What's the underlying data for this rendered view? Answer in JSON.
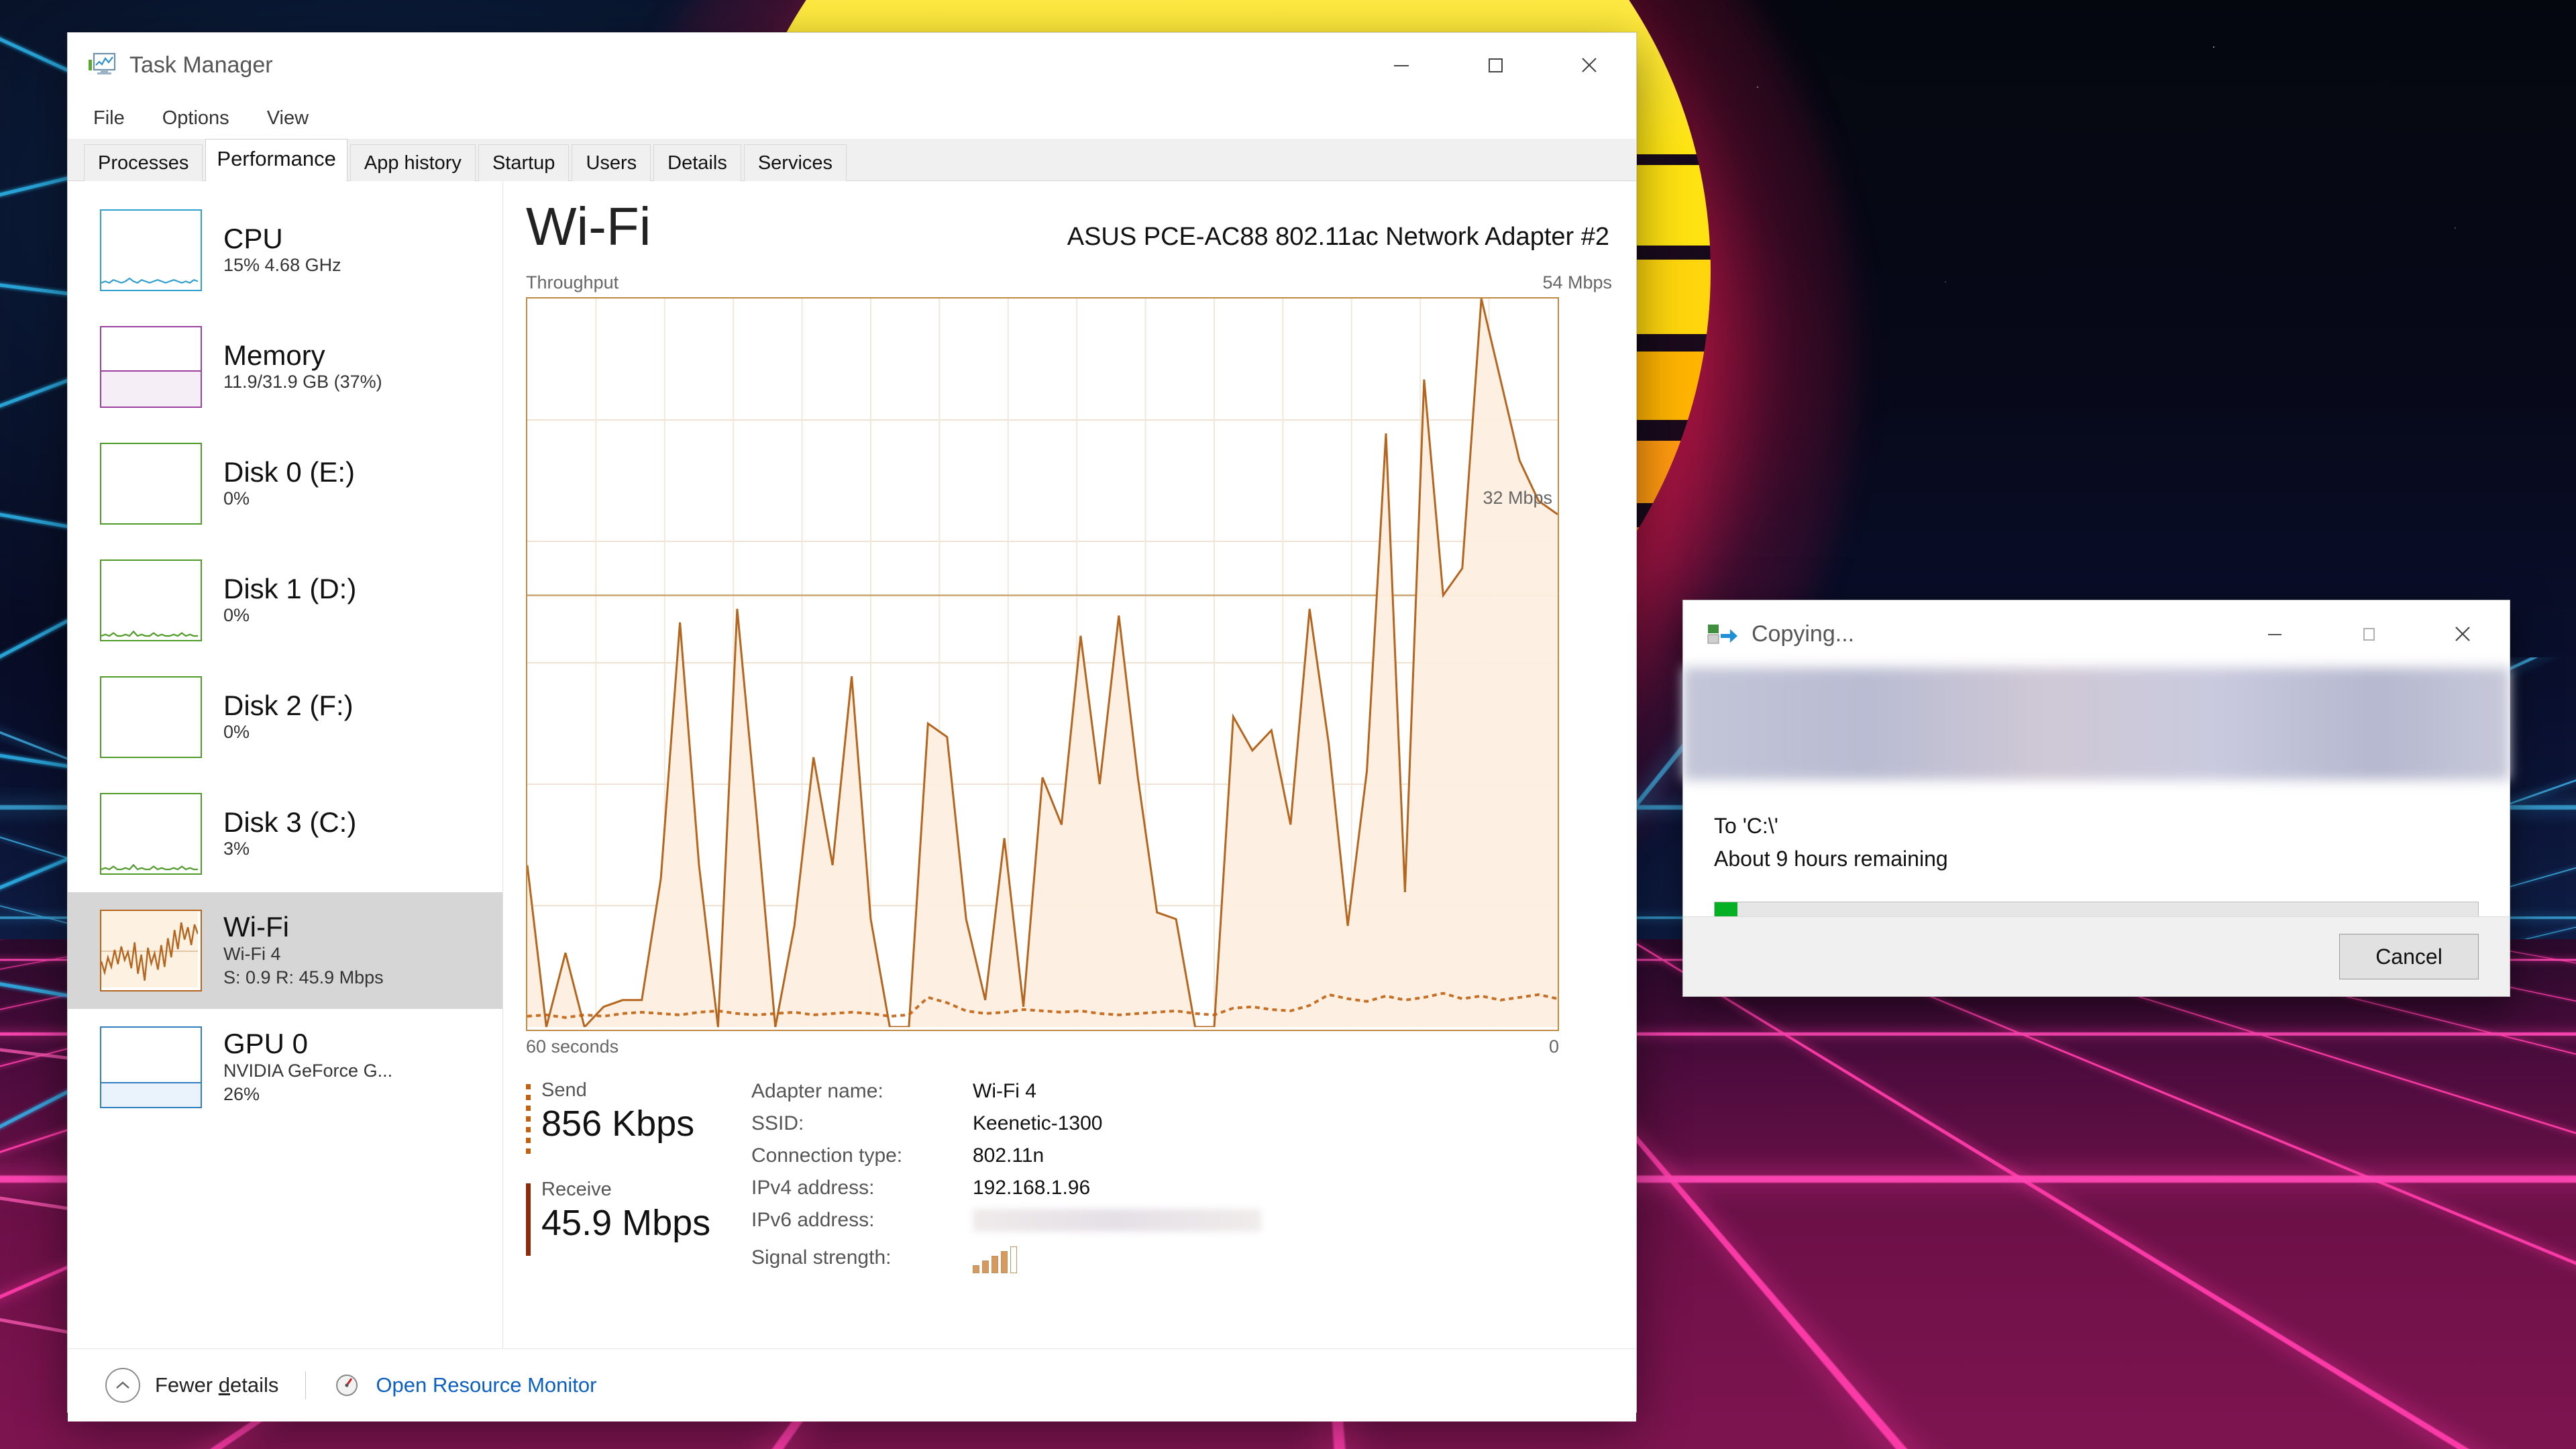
{
  "taskmanager": {
    "title": "Task Manager",
    "icon": "task-manager-icon",
    "caption": {
      "minimize": "–",
      "maximize": "□",
      "close": "✕"
    },
    "menu": [
      "File",
      "Options",
      "View"
    ],
    "tabs": [
      {
        "label": "Processes",
        "active": false
      },
      {
        "label": "Performance",
        "active": true
      },
      {
        "label": "App history",
        "active": false
      },
      {
        "label": "Startup",
        "active": false
      },
      {
        "label": "Users",
        "active": false
      },
      {
        "label": "Details",
        "active": false
      },
      {
        "label": "Services",
        "active": false
      }
    ],
    "sidebar": [
      {
        "name": "CPU",
        "sub1": "15%  4.68 GHz",
        "sub2": "",
        "color": "#2f9fd0",
        "fill": "#ffffff",
        "selected": false,
        "spark": "cpu"
      },
      {
        "name": "Memory",
        "sub1": "11.9/31.9 GB (37%)",
        "sub2": "",
        "color": "#9b3fa0",
        "fill": "#f6eef7",
        "selected": false,
        "spark": "mem"
      },
      {
        "name": "Disk 0 (E:)",
        "sub1": "0%",
        "sub2": "",
        "color": "#4f9b27",
        "fill": "#ffffff",
        "selected": false,
        "spark": "flat"
      },
      {
        "name": "Disk 1 (D:)",
        "sub1": "0%",
        "sub2": "",
        "color": "#4f9b27",
        "fill": "#ffffff",
        "selected": false,
        "spark": "low"
      },
      {
        "name": "Disk 2 (F:)",
        "sub1": "0%",
        "sub2": "",
        "color": "#4f9b27",
        "fill": "#ffffff",
        "selected": false,
        "spark": "flat"
      },
      {
        "name": "Disk 3 (C:)",
        "sub1": "3%",
        "sub2": "",
        "color": "#4f9b27",
        "fill": "#ffffff",
        "selected": false,
        "spark": "low"
      },
      {
        "name": "Wi-Fi",
        "sub1": "Wi-Fi 4",
        "sub2": "S: 0.9 R: 45.9 Mbps",
        "color": "#b5651d",
        "fill": "#fdf1e2",
        "selected": true,
        "spark": "wifi"
      },
      {
        "name": "GPU 0",
        "sub1": "NVIDIA GeForce G...",
        "sub2": "26%",
        "color": "#2f7fc0",
        "fill": "#eaf3fb",
        "selected": false,
        "spark": "gpu"
      }
    ],
    "detail": {
      "title": "Wi-Fi",
      "adapter": "ASUS PCE-AC88 802.11ac Network Adapter #2",
      "graph_label": "Throughput",
      "graph_max": "54 Mbps",
      "graph_inner_label": "32 Mbps",
      "x_left": "60 seconds",
      "x_right": "0",
      "send_label": "Send",
      "send_value": "856 Kbps",
      "receive_label": "Receive",
      "receive_value": "45.9 Mbps",
      "info": [
        {
          "key": "Adapter name:",
          "value": "Wi-Fi 4",
          "type": "text"
        },
        {
          "key": "SSID:",
          "value": "Keenetic-1300",
          "type": "text"
        },
        {
          "key": "Connection type:",
          "value": "802.11n",
          "type": "text"
        },
        {
          "key": "IPv4 address:",
          "value": "192.168.1.96",
          "type": "text"
        },
        {
          "key": "IPv6 address:",
          "value": "",
          "type": "blurred"
        },
        {
          "key": "Signal strength:",
          "value": "",
          "type": "signal",
          "bars": 5,
          "filled": 4
        }
      ]
    },
    "footer": {
      "fewer_details": "Fewer details",
      "fewer_details_accel": "d",
      "resource_monitor": "Open Resource Monitor",
      "chevron_icon": "chevron-up-icon",
      "monitor_icon": "resource-monitor-icon"
    }
  },
  "copy_dialog": {
    "title": "Copying...",
    "icon": "copy-files-icon",
    "caption": {
      "minimize": "–",
      "maximize": "□",
      "close": "✕"
    },
    "destination": "To 'C:\\'",
    "remaining": "About 9 hours remaining",
    "progress_percent": 3,
    "progress_color": "#06b025",
    "cancel_label": "Cancel"
  },
  "chart_data": {
    "type": "area",
    "title": "Throughput",
    "ylabel": "Mbps",
    "xlabel": "",
    "ylim": [
      0,
      54
    ],
    "xlim": [
      60,
      0
    ],
    "x_tick_labels": [
      "60 seconds",
      "0"
    ],
    "y_top_label": "54 Mbps",
    "annotations": [
      {
        "text": "32 Mbps",
        "y": 32
      }
    ],
    "grid": true,
    "series": [
      {
        "name": "Receive",
        "color": "#b5651d",
        "fill": "#fdefe0",
        "values": [
          12,
          0,
          5.5,
          0,
          1.5,
          2,
          2,
          11,
          30,
          12,
          0,
          31,
          16,
          0,
          7.5,
          20,
          12,
          26,
          8,
          0,
          0,
          22.5,
          21.5,
          8,
          2,
          14,
          1.5,
          18.5,
          15,
          29,
          18,
          30.5,
          18.5,
          8.5,
          8,
          0,
          0,
          23,
          20.5,
          22,
          15,
          31,
          21,
          7.5,
          19,
          44,
          10,
          48,
          32,
          34,
          54,
          48,
          42,
          39,
          38
        ]
      },
      {
        "name": "Send",
        "color": "#c2600f",
        "fill": "none",
        "values": [
          0.8,
          0.9,
          0.7,
          0.9,
          0.8,
          1.0,
          1.1,
          1.0,
          0.9,
          1.1,
          1.2,
          1.0,
          0.9,
          1.0,
          1.1,
          0.9,
          1.0,
          1.1,
          1.0,
          0.8,
          0.9,
          2.2,
          1.8,
          1.2,
          1.0,
          1.1,
          1.3,
          1.2,
          1.1,
          1.2,
          1.0,
          0.9,
          1.0,
          1.1,
          1.2,
          1.0,
          0.9,
          1.4,
          1.5,
          1.3,
          1.2,
          1.6,
          2.4,
          2.1,
          1.9,
          2.3,
          2.0,
          2.2,
          2.5,
          2.1,
          2.3,
          2.0,
          2.2,
          2.4,
          2.1
        ]
      }
    ]
  }
}
